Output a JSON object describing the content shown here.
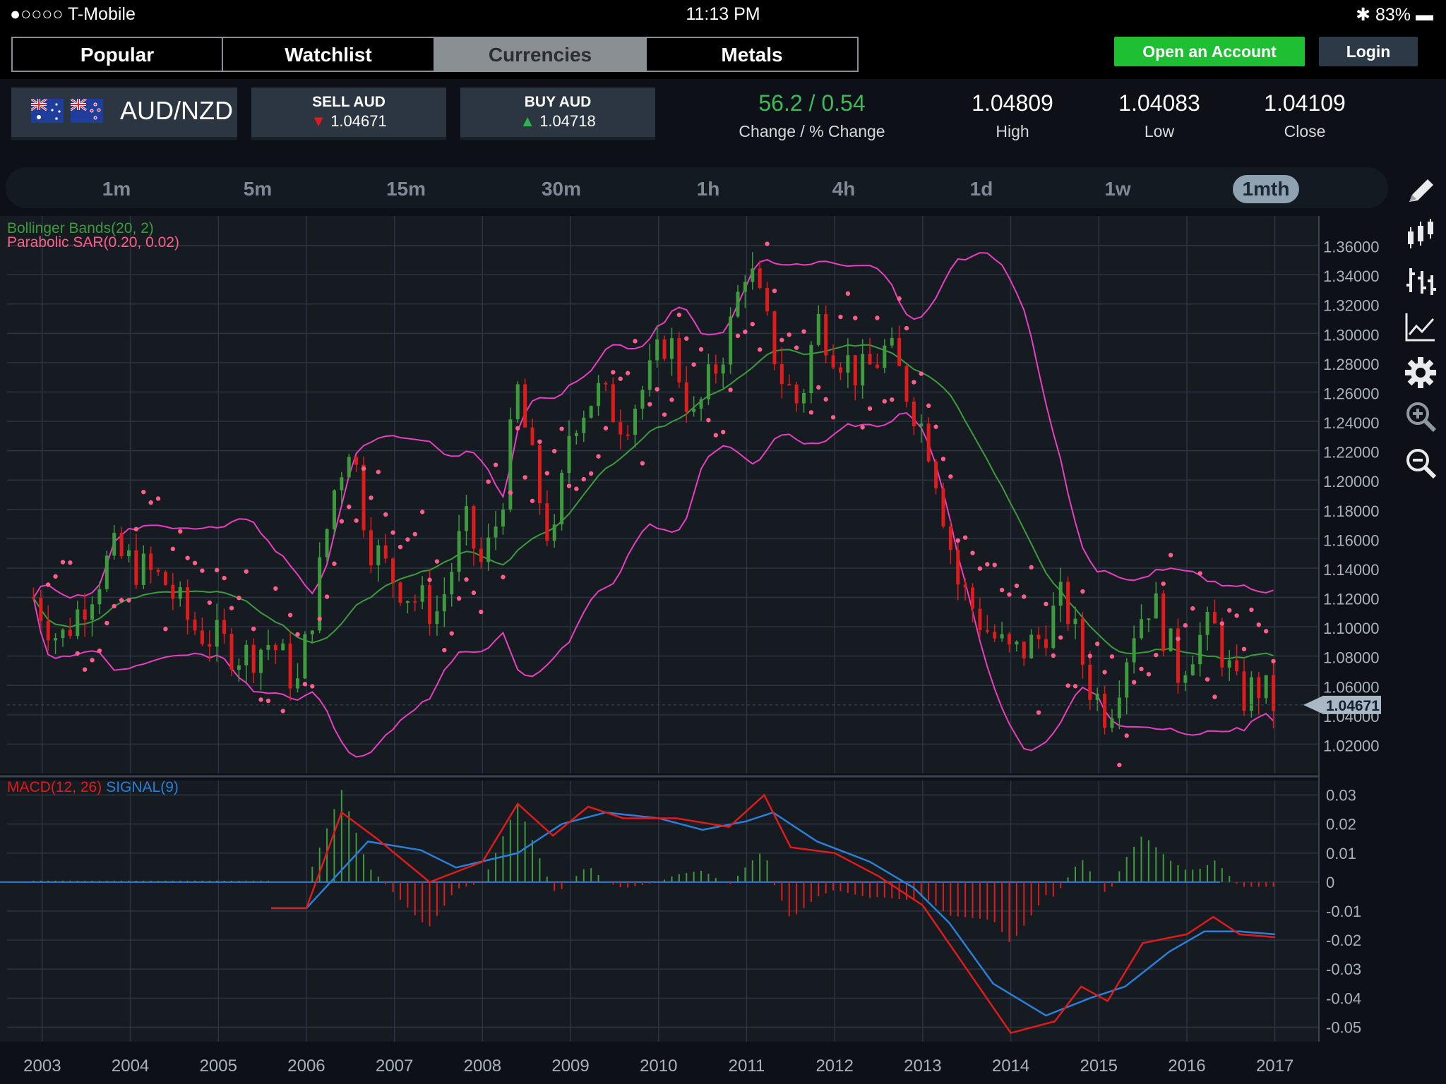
{
  "status_bar": {
    "carrier": "●○○○○ T-Mobile",
    "time": "11:13 PM",
    "battery": "83%"
  },
  "nav_tabs": [
    {
      "label": "Popular",
      "active": false
    },
    {
      "label": "Watchlist",
      "active": false
    },
    {
      "label": "Currencies",
      "active": true
    },
    {
      "label": "Metals",
      "active": false
    }
  ],
  "actions": {
    "open_account": "Open an Account",
    "login": "Login"
  },
  "pair": {
    "symbol": "AUD/NZD",
    "flags": [
      "australia-flag-icon",
      "new-zealand-flag-icon"
    ]
  },
  "sell": {
    "label": "SELL AUD",
    "price": "1.04671"
  },
  "buy": {
    "label": "BUY AUD",
    "price": "1.04718"
  },
  "stats": [
    {
      "value": "56.2 / 0.54",
      "label": "Change / % Change",
      "color": "#3dbb5a"
    },
    {
      "value": "1.04809",
      "label": "High"
    },
    {
      "value": "1.04083",
      "label": "Low"
    },
    {
      "value": "1.04109",
      "label": "Close"
    }
  ],
  "timeframes": [
    "1m",
    "5m",
    "15m",
    "30m",
    "1h",
    "4h",
    "1d",
    "1w",
    "1mth"
  ],
  "active_timeframe": "1mth",
  "tools": [
    "pencil-icon",
    "candlestick-icon",
    "bar-chart-icon",
    "line-chart-icon",
    "gear-icon",
    "zoom-in-icon",
    "zoom-out-icon"
  ],
  "colors": {
    "up": "#3d9a3d",
    "down": "#e01b1b",
    "bollinger": "#e83ec0",
    "sar": "#ff5e8a",
    "macd": "#e01b1b",
    "signal": "#2a7fd6",
    "grid": "#2c3440"
  },
  "chart_data": [
    {
      "type": "candlestick",
      "indicators": [
        "Bollinger Bands(20, 2)",
        "Parabolic SAR(0.20, 0.02)"
      ],
      "x_ticks": [
        "2003",
        "2004",
        "2005",
        "2006",
        "2007",
        "2008",
        "2009",
        "2010",
        "2011",
        "2012",
        "2013",
        "2014",
        "2015",
        "2016",
        "2017"
      ],
      "y_ticks": [
        "1.36000",
        "1.34000",
        "1.32000",
        "1.30000",
        "1.28000",
        "1.26000",
        "1.24000",
        "1.22000",
        "1.20000",
        "1.18000",
        "1.16000",
        "1.14000",
        "1.12000",
        "1.10000",
        "1.08000",
        "1.06000",
        "1.04000",
        "1.02000"
      ],
      "ylim": [
        1.0,
        1.38
      ],
      "current_price": "1.04671",
      "close_series": [
        {
          "x": 2002.9,
          "y": 1.12
        },
        {
          "x": 2003.2,
          "y": 1.09
        },
        {
          "x": 2003.5,
          "y": 1.12
        },
        {
          "x": 2003.8,
          "y": 1.15
        },
        {
          "x": 2004.1,
          "y": 1.14
        },
        {
          "x": 2004.4,
          "y": 1.13
        },
        {
          "x": 2004.7,
          "y": 1.1
        },
        {
          "x": 2005.0,
          "y": 1.09
        },
        {
          "x": 2005.3,
          "y": 1.08
        },
        {
          "x": 2005.6,
          "y": 1.09
        },
        {
          "x": 2005.9,
          "y": 1.06
        },
        {
          "x": 2006.1,
          "y": 1.12
        },
        {
          "x": 2006.3,
          "y": 1.19
        },
        {
          "x": 2006.5,
          "y": 1.23
        },
        {
          "x": 2006.7,
          "y": 1.16
        },
        {
          "x": 2006.9,
          "y": 1.14
        },
        {
          "x": 2007.2,
          "y": 1.12
        },
        {
          "x": 2007.5,
          "y": 1.11
        },
        {
          "x": 2007.8,
          "y": 1.17
        },
        {
          "x": 2008.0,
          "y": 1.14
        },
        {
          "x": 2008.2,
          "y": 1.18
        },
        {
          "x": 2008.4,
          "y": 1.26
        },
        {
          "x": 2008.6,
          "y": 1.2
        },
        {
          "x": 2008.8,
          "y": 1.15
        },
        {
          "x": 2009.0,
          "y": 1.24
        },
        {
          "x": 2009.3,
          "y": 1.26
        },
        {
          "x": 2009.6,
          "y": 1.24
        },
        {
          "x": 2009.9,
          "y": 1.27
        },
        {
          "x": 2010.1,
          "y": 1.3
        },
        {
          "x": 2010.4,
          "y": 1.24
        },
        {
          "x": 2010.6,
          "y": 1.27
        },
        {
          "x": 2010.8,
          "y": 1.3
        },
        {
          "x": 2011.0,
          "y": 1.35
        },
        {
          "x": 2011.2,
          "y": 1.31
        },
        {
          "x": 2011.4,
          "y": 1.27
        },
        {
          "x": 2011.6,
          "y": 1.25
        },
        {
          "x": 2011.8,
          "y": 1.31
        },
        {
          "x": 2012.0,
          "y": 1.29
        },
        {
          "x": 2012.3,
          "y": 1.27
        },
        {
          "x": 2012.6,
          "y": 1.29
        },
        {
          "x": 2012.9,
          "y": 1.25
        },
        {
          "x": 2013.1,
          "y": 1.22
        },
        {
          "x": 2013.4,
          "y": 1.13
        },
        {
          "x": 2013.7,
          "y": 1.1
        },
        {
          "x": 2014.0,
          "y": 1.08
        },
        {
          "x": 2014.3,
          "y": 1.09
        },
        {
          "x": 2014.6,
          "y": 1.12
        },
        {
          "x": 2014.9,
          "y": 1.06
        },
        {
          "x": 2015.1,
          "y": 1.04
        },
        {
          "x": 2015.4,
          "y": 1.1
        },
        {
          "x": 2015.6,
          "y": 1.12
        },
        {
          "x": 2015.9,
          "y": 1.07
        },
        {
          "x": 2016.1,
          "y": 1.09
        },
        {
          "x": 2016.3,
          "y": 1.1
        },
        {
          "x": 2016.6,
          "y": 1.05
        },
        {
          "x": 2016.8,
          "y": 1.06
        },
        {
          "x": 2017.0,
          "y": 1.047
        }
      ]
    },
    {
      "type": "line",
      "title": "MACD(12, 26) SIGNAL(9)",
      "series": [
        {
          "name": "MACD(12, 26)"
        },
        {
          "name": "SIGNAL(9)"
        }
      ],
      "y_ticks": [
        "0.03",
        "0.02",
        "0.01",
        "0",
        "-0.01",
        "-0.02",
        "-0.03",
        "-0.04",
        "-0.05"
      ],
      "ylim": [
        -0.055,
        0.035
      ],
      "macd": [
        {
          "x": 2005.6,
          "y": -0.009
        },
        {
          "x": 2006.0,
          "y": -0.009
        },
        {
          "x": 2006.4,
          "y": 0.024
        },
        {
          "x": 2006.8,
          "y": 0.015
        },
        {
          "x": 2007.4,
          "y": 0.0
        },
        {
          "x": 2008.0,
          "y": 0.007
        },
        {
          "x": 2008.4,
          "y": 0.027
        },
        {
          "x": 2008.8,
          "y": 0.016
        },
        {
          "x": 2009.2,
          "y": 0.026
        },
        {
          "x": 2009.6,
          "y": 0.022
        },
        {
          "x": 2010.2,
          "y": 0.022
        },
        {
          "x": 2010.8,
          "y": 0.019
        },
        {
          "x": 2011.2,
          "y": 0.03
        },
        {
          "x": 2011.5,
          "y": 0.012
        },
        {
          "x": 2012.0,
          "y": 0.01
        },
        {
          "x": 2012.5,
          "y": 0.002
        },
        {
          "x": 2013.0,
          "y": -0.008
        },
        {
          "x": 2013.5,
          "y": -0.03
        },
        {
          "x": 2014.0,
          "y": -0.052
        },
        {
          "x": 2014.5,
          "y": -0.048
        },
        {
          "x": 2014.8,
          "y": -0.036
        },
        {
          "x": 2015.1,
          "y": -0.041
        },
        {
          "x": 2015.5,
          "y": -0.021
        },
        {
          "x": 2016.0,
          "y": -0.018
        },
        {
          "x": 2016.3,
          "y": -0.012
        },
        {
          "x": 2016.6,
          "y": -0.018
        },
        {
          "x": 2017.0,
          "y": -0.019
        }
      ],
      "signal": [
        {
          "x": 2005.6,
          "y": -0.009
        },
        {
          "x": 2006.0,
          "y": -0.009
        },
        {
          "x": 2006.7,
          "y": 0.014
        },
        {
          "x": 2007.3,
          "y": 0.011
        },
        {
          "x": 2007.7,
          "y": 0.005
        },
        {
          "x": 2008.4,
          "y": 0.01
        },
        {
          "x": 2008.9,
          "y": 0.02
        },
        {
          "x": 2009.4,
          "y": 0.024
        },
        {
          "x": 2010.0,
          "y": 0.022
        },
        {
          "x": 2010.5,
          "y": 0.018
        },
        {
          "x": 2011.0,
          "y": 0.021
        },
        {
          "x": 2011.3,
          "y": 0.024
        },
        {
          "x": 2011.8,
          "y": 0.014
        },
        {
          "x": 2012.4,
          "y": 0.007
        },
        {
          "x": 2012.9,
          "y": -0.002
        },
        {
          "x": 2013.3,
          "y": -0.014
        },
        {
          "x": 2013.8,
          "y": -0.035
        },
        {
          "x": 2014.4,
          "y": -0.046
        },
        {
          "x": 2014.9,
          "y": -0.04
        },
        {
          "x": 2015.3,
          "y": -0.036
        },
        {
          "x": 2015.8,
          "y": -0.024
        },
        {
          "x": 2016.2,
          "y": -0.017
        },
        {
          "x": 2016.6,
          "y": -0.017
        },
        {
          "x": 2017.0,
          "y": -0.018
        }
      ]
    }
  ]
}
